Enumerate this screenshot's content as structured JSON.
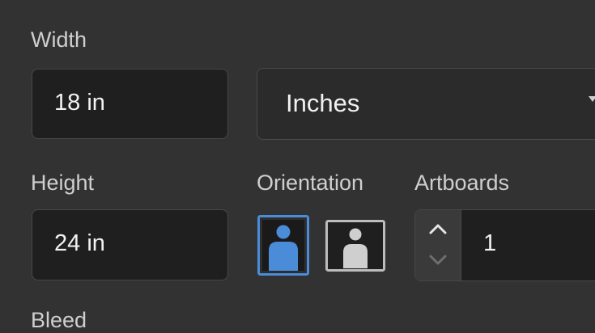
{
  "width": {
    "label": "Width",
    "value": "18 in"
  },
  "units": {
    "selected": "Inches",
    "icon": "chevron-down-icon"
  },
  "height": {
    "label": "Height",
    "value": "24 in"
  },
  "orientation": {
    "label": "Orientation",
    "options": [
      {
        "name": "portrait",
        "icon": "portrait-orientation-icon",
        "selected": true
      },
      {
        "name": "landscape",
        "icon": "landscape-orientation-icon",
        "selected": false
      }
    ],
    "accent_color": "#4a8cd8"
  },
  "artboards": {
    "label": "Artboards",
    "value": "1"
  },
  "bleed": {
    "label": "Bleed"
  }
}
